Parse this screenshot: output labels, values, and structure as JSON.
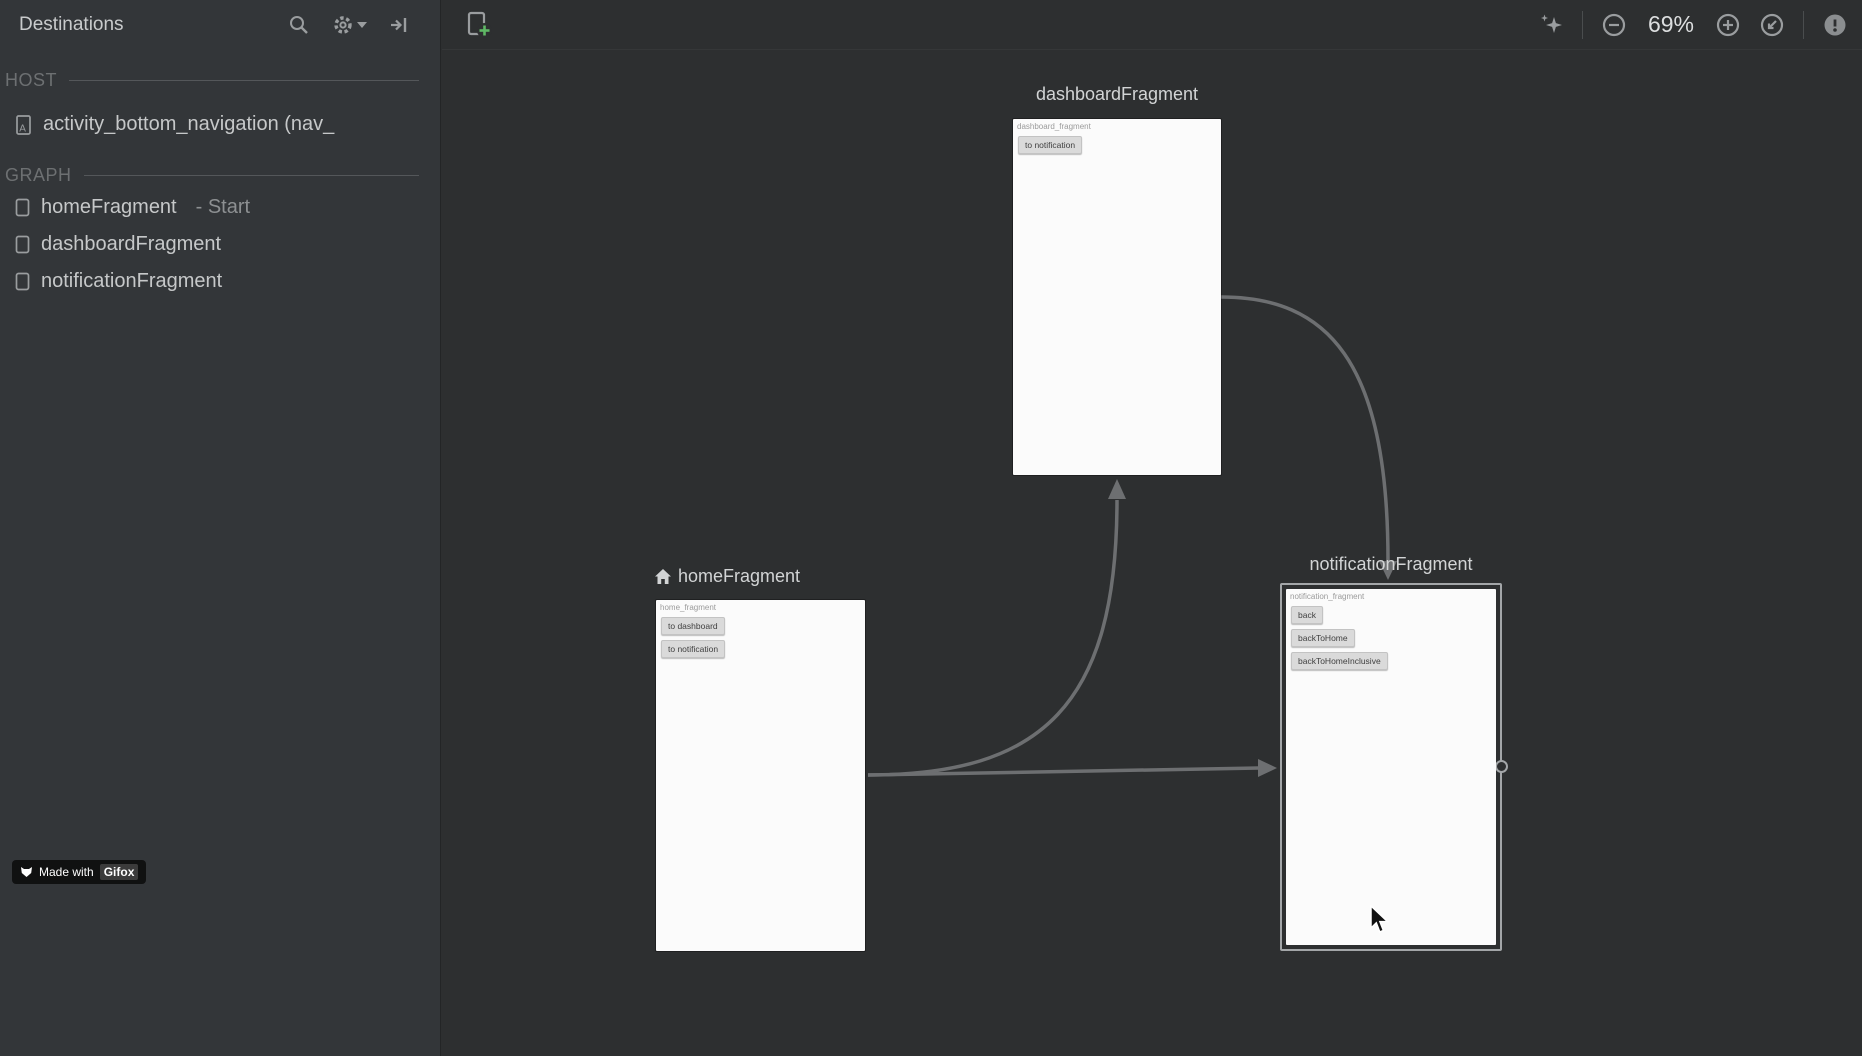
{
  "sidebar": {
    "title": "Destinations",
    "sections": {
      "host_label": "HOST",
      "graph_label": "GRAPH"
    },
    "host_item": {
      "label": "activity_bottom_navigation (nav_"
    },
    "graph_items": [
      {
        "label": "homeFragment",
        "suffix": "- Start"
      },
      {
        "label": "dashboardFragment",
        "suffix": ""
      },
      {
        "label": "notificationFragment",
        "suffix": ""
      }
    ]
  },
  "toolbar": {
    "zoom_level": "69%"
  },
  "canvas": {
    "fragments": [
      {
        "title": "dashboardFragment",
        "layout_id": "dashboard_fragment",
        "buttons": [
          "to notification"
        ]
      },
      {
        "title": "homeFragment",
        "layout_id": "home_fragment",
        "buttons": [
          "to dashboard",
          "to notification"
        ]
      },
      {
        "title": "notificationFragment",
        "layout_id": "notification_fragment",
        "buttons": [
          "back",
          "backToHome",
          "backToHomeInclusive"
        ]
      }
    ]
  },
  "watermark": {
    "prefix": "Made with",
    "brand": "Gifox"
  },
  "colors": {
    "accent_green": "#5fb865",
    "selection_border": "#a3a6a8",
    "arrow": "#6d6f71",
    "canvas_bg": "#2d2f30",
    "sidebar_bg": "#333639"
  }
}
